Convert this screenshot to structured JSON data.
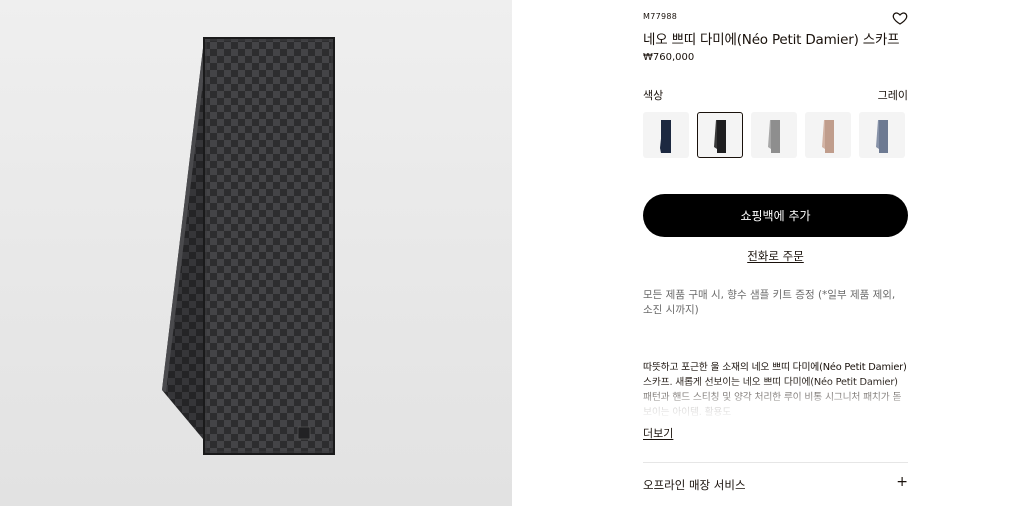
{
  "product": {
    "sku": "M77988",
    "title": "네오 쁘띠 다미에(Néo Petit Damier) 스카프",
    "price": "₩760,000",
    "product_image_icon": "scarf-image"
  },
  "color": {
    "label": "색상",
    "selected": "그레이",
    "swatches": [
      {
        "name": "navy",
        "color": "#1c2840"
      },
      {
        "name": "black",
        "color": "#1e1e20"
      },
      {
        "name": "grey",
        "color": "#8e8e8e"
      },
      {
        "name": "beige",
        "color": "#c09d8c"
      },
      {
        "name": "blue-grey",
        "color": "#6d7a92"
      }
    ]
  },
  "actions": {
    "add_to_bag": "쇼핑백에 추가",
    "order_by_phone": "전화로 주문"
  },
  "promo": "모든 제품 구매 시, 향수 샘플 키트 증정 (*일부 제품 제외, 소진 시까지)",
  "description": "따뜻하고 포근한 울 소재의 네오 쁘띠 다미에(Néo Petit Damier) 스카프. 새롭게 선보이는 네오 쁘띠 다미에(Néo Petit Damier) 패턴과 핸드 스티칭 및 양각 처리한 루이 비통 시그니처 패치가 돋보이는 아이템. 활용도",
  "read_more": "더보기",
  "services": {
    "offline_label": "오프라인 매장 서비스",
    "expand_symbol": "+"
  },
  "icons": {
    "wishlist": "heart-icon",
    "expand": "plus-icon"
  }
}
